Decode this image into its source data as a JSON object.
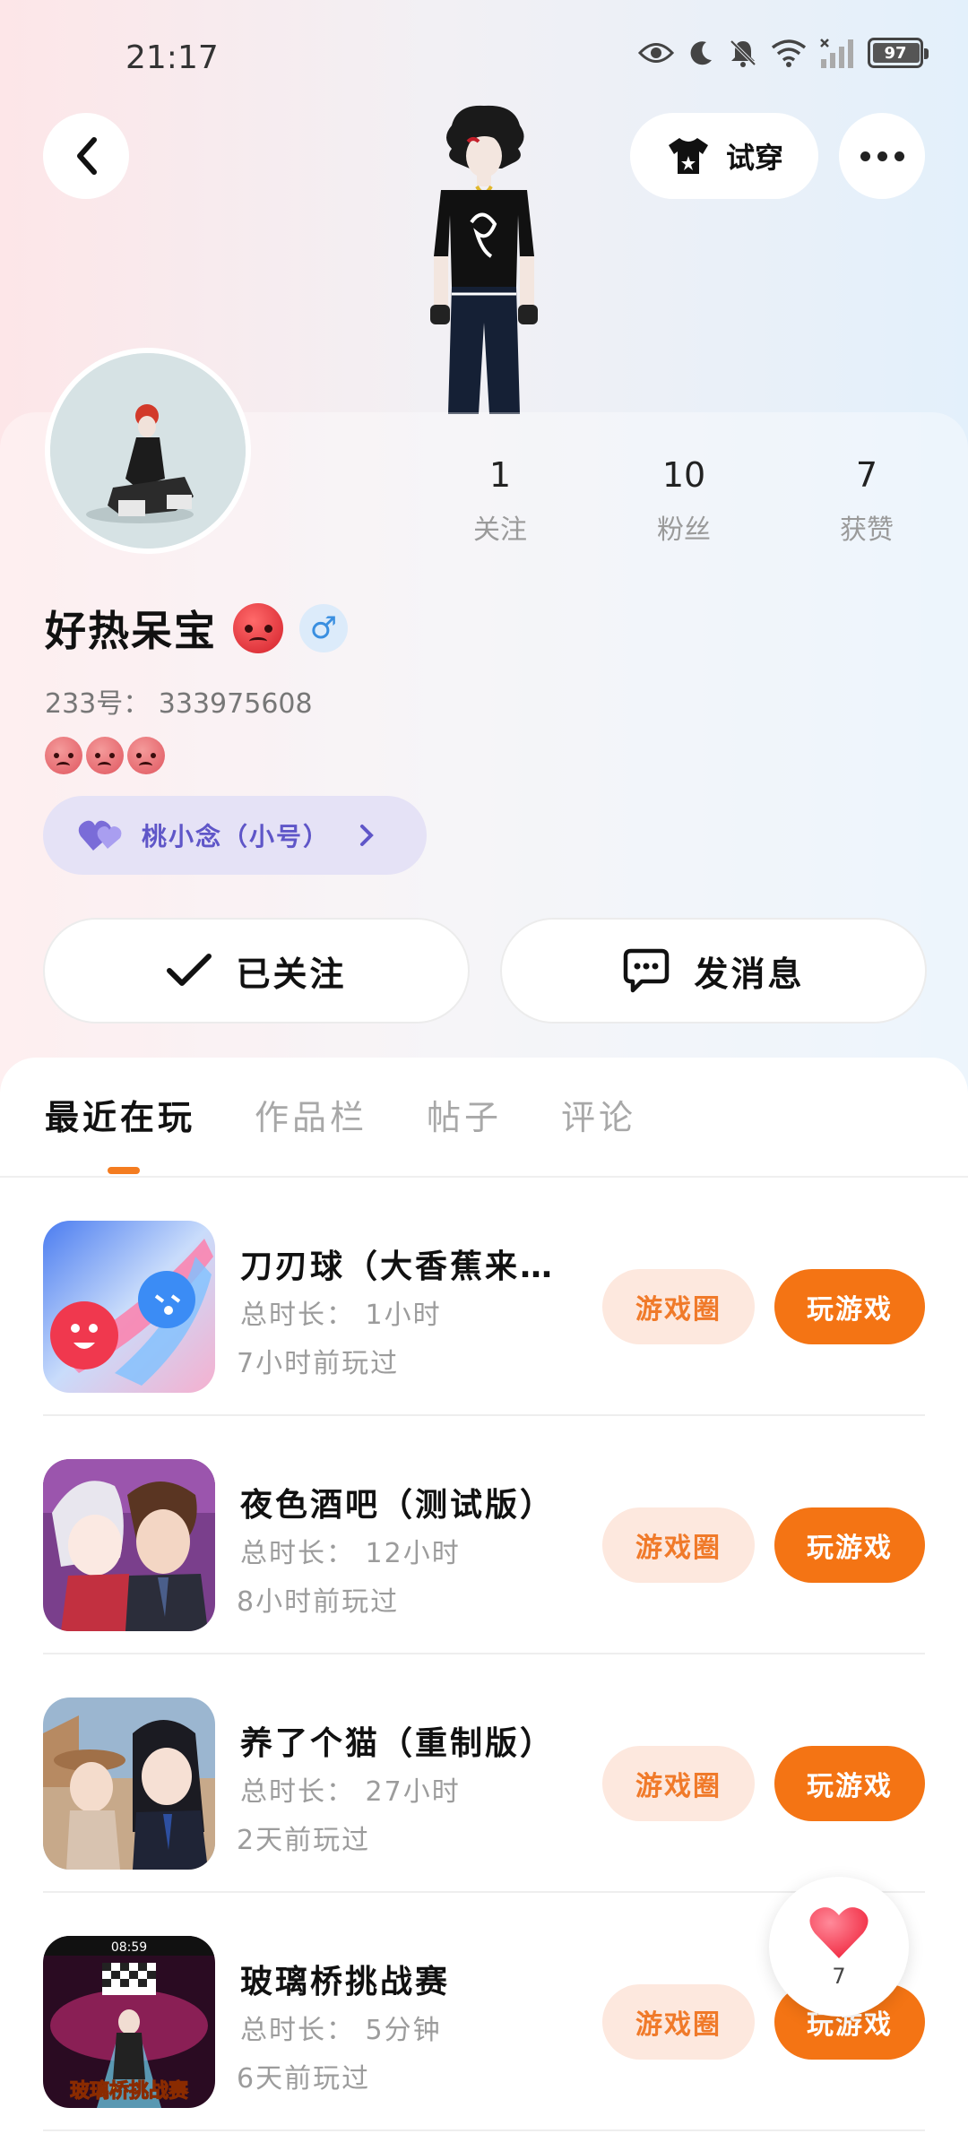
{
  "status_bar": {
    "time": "21:17",
    "battery": "97"
  },
  "header": {
    "tryon_label": "试穿"
  },
  "profile": {
    "stats": [
      {
        "value": "1",
        "label": "关注"
      },
      {
        "value": "10",
        "label": "粉丝"
      },
      {
        "value": "7",
        "label": "获赞"
      }
    ],
    "username": "好热呆宝",
    "gender_symbol": "♂",
    "id_line": "233号： 333975608",
    "alt_account": "桃小念（小号）",
    "following_label": "已关注",
    "message_label": "发消息"
  },
  "tabs": [
    {
      "label": "最近在玩",
      "active": true
    },
    {
      "label": "作品栏",
      "active": false
    },
    {
      "label": "帖子",
      "active": false
    },
    {
      "label": "评论",
      "active": false
    }
  ],
  "games": [
    {
      "title": "刀刃球（大香蕉来…",
      "duration": "总时长： 1小时",
      "last_played": "7小时前玩过",
      "circle_label": "游戏圈",
      "play_label": "玩游戏"
    },
    {
      "title": "夜色酒吧（测试版）",
      "duration": "总时长： 12小时",
      "last_played": "8小时前玩过",
      "circle_label": "游戏圈",
      "play_label": "玩游戏"
    },
    {
      "title": "养了个猫（重制版）",
      "duration": "总时长： 27小时",
      "last_played": "2天前玩过",
      "circle_label": "游戏圈",
      "play_label": "玩游戏"
    },
    {
      "title": "玻璃桥挑战赛",
      "duration": "总时长： 5分钟",
      "last_played": "6天前玩过",
      "circle_label": "游戏圈",
      "play_label": "玩游戏"
    }
  ],
  "game4_icon": {
    "hud_time": "08:59",
    "banner": "玻璃桥挑战赛"
  },
  "like_fab": {
    "count": "7"
  },
  "colors": {
    "accent": "#f47414",
    "accent_light": "#fde8de",
    "alt_account": "#5f56c8"
  }
}
